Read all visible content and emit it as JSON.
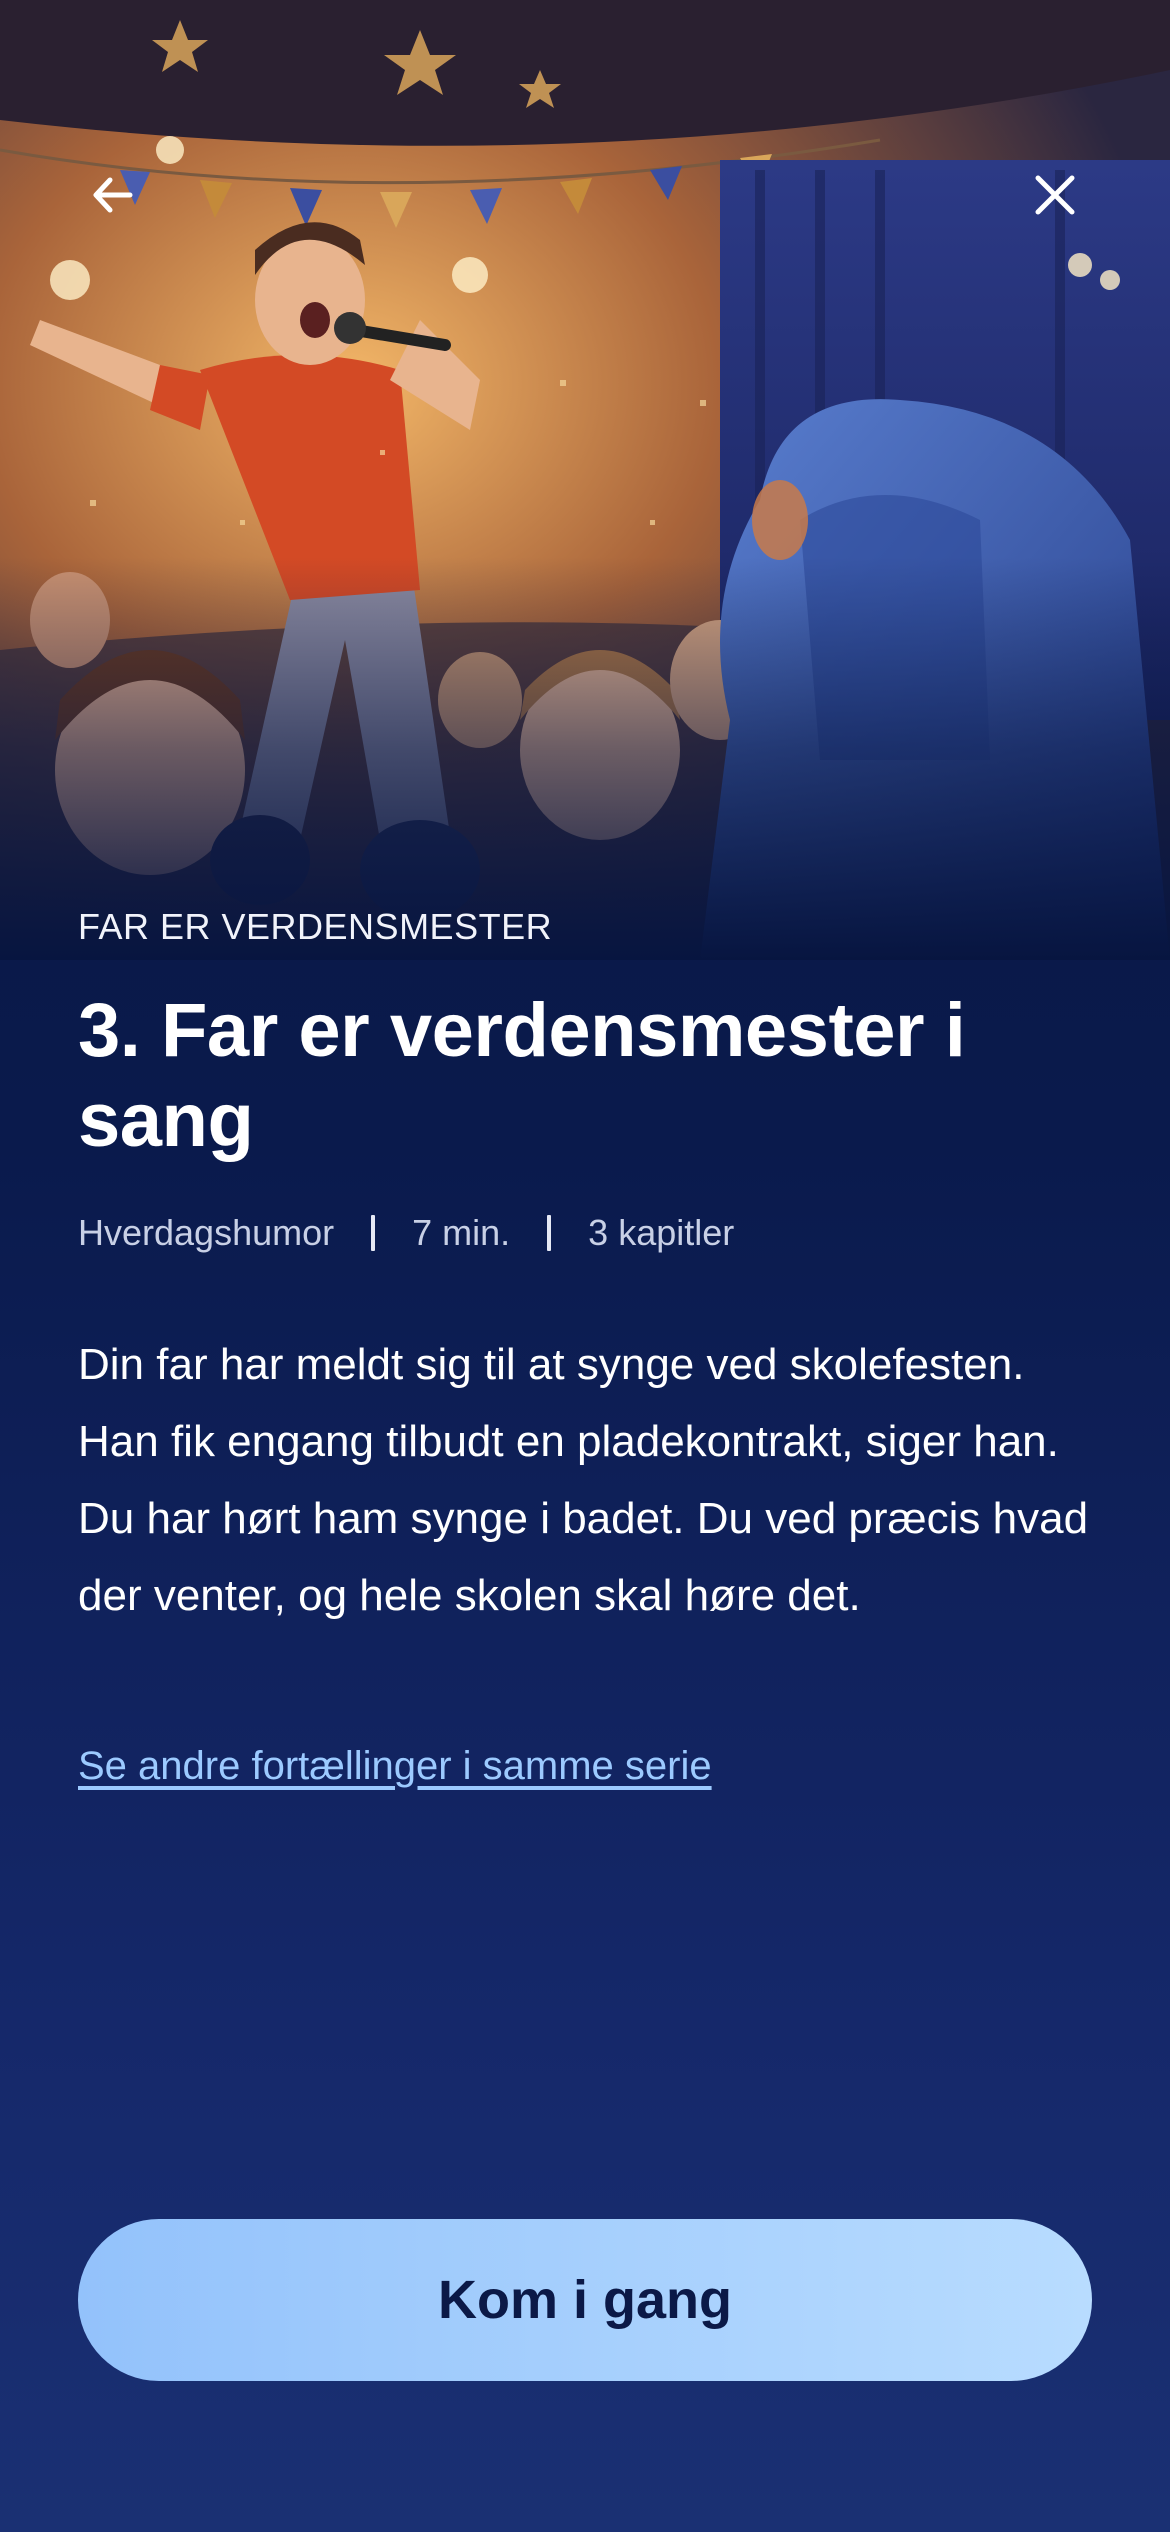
{
  "hero": {
    "image_subject": "cartoon father singing with microphone on school stage, audience of children, hooded child watching"
  },
  "nav": {
    "back_icon": "arrow-left-icon",
    "close_icon": "close-icon"
  },
  "story": {
    "series_label": "FAR ER VERDENSMESTER",
    "title": "3. Far er verdensmester i sang",
    "meta": {
      "category": "Hverdagshumor",
      "duration": "7 min.",
      "chapters": "3 kapitler"
    },
    "description": "Din far har meldt sig til at synge ved skolefesten. Han fik engang tilbudt en pladekontrakt, siger han. Du har hørt ham synge i badet. Du ved præcis hvad der venter, og hele skolen skal høre det.",
    "series_link": "Se andre fortællinger i samme serie"
  },
  "cta": {
    "label": "Kom i gang"
  },
  "colors": {
    "background": "#0b1a4a",
    "cta_start": "#93c2fb",
    "cta_end": "#b8dcff",
    "link": "#9ccaff"
  }
}
